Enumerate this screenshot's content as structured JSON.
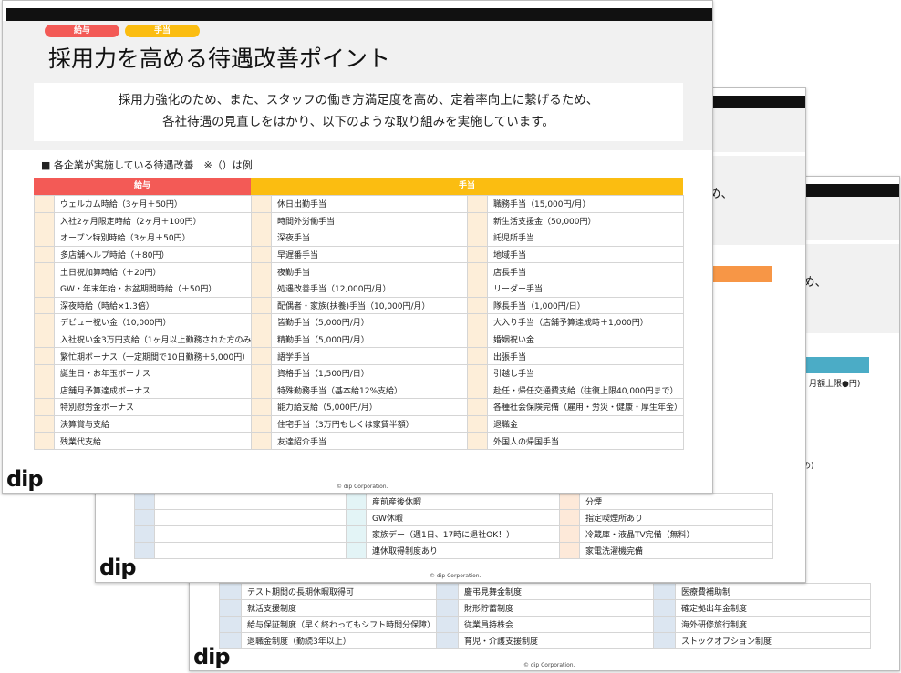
{
  "front": {
    "tags": [
      "給与",
      "手当"
    ],
    "title": "採用力を高める待遇改善ポイント",
    "lead_line1": "採用力強化のため、また、スタッフの働き方満足度を高め、定着率向上に繋げるため、",
    "lead_line2": "各社待遇の見直しをはかり、以下のような取り組みを実施しています。",
    "section_label": "■ 各企業が実施している待遇改善　※（）は例",
    "header_salary": "給与",
    "header_allowance": "手当",
    "colors": {
      "salary": "#f35a56",
      "allowance": "#fbbd11",
      "marker": "#fdeed9"
    },
    "rows": [
      [
        "ウェルカム時給（3ヶ月＋50円）",
        "休日出勤手当",
        "職務手当（15,000円/月）"
      ],
      [
        "入社2ヶ月限定時給（2ヶ月＋100円）",
        "時間外労働手当",
        "新生活支援金（50,000円）"
      ],
      [
        "オープン特別時給（3ヶ月＋50円）",
        "深夜手当",
        "託児所手当"
      ],
      [
        "多店舗ヘルプ時給（＋80円）",
        "早遅番手当",
        "地域手当"
      ],
      [
        "土日祝加算時給（＋20円）",
        "夜勤手当",
        "店長手当"
      ],
      [
        "GW・年末年始・お盆期間時給（＋50円）",
        "処遇改善手当（12,000円/月）",
        "リーダー手当"
      ],
      [
        "深夜時給（時給×1.3倍）",
        "配偶者・家族(扶養)手当（10,000円/月）",
        "隊長手当（1,000円/日）"
      ],
      [
        "デビュー祝い金（10,000円）",
        "皆勤手当（5,000円/月）",
        "大入り手当（店舗予算達成時＋1,000円）"
      ],
      [
        "入社祝い金3万円支給（1ヶ月以上勤務された方のみ）",
        "精勤手当（5,000円/月）",
        "婚姻祝い金"
      ],
      [
        "繁忙期ボーナス（一定期間で10日勤務＋5,000円）",
        "語学手当",
        "出張手当"
      ],
      [
        "誕生日・お年玉ボーナス",
        "資格手当（1,500円/日）",
        "引越し手当"
      ],
      [
        "店舗月予算達成ボーナス",
        "特殊勤務手当（基本給12%支給）",
        "赴任・帰任交通費支給（往復上限40,000円まで）"
      ],
      [
        "特別慰労金ボーナス",
        "能力給支給（5,000円/月）",
        "各種社会保険完備（雇用・労災・健康・厚生年金）"
      ],
      [
        "決算賞与支給",
        "住宅手当（3万円もしくは家賃半額）",
        "退職金"
      ],
      [
        "残業代支給",
        "友達紹介手当",
        "外国人の帰国手当"
      ]
    ],
    "logo": "dip",
    "copyright": "© dip Corporation."
  },
  "middle": {
    "partial_text1": "め、",
    "header_color": "#f79646",
    "rows": [
      [
        "",
        "産前産後休暇",
        "分煙"
      ],
      [
        "",
        "GW休暇",
        "指定喫煙所あり"
      ],
      [
        "",
        "家族デー（週1日、17時に退社OK！）",
        "冷蔵庫・液晶TV完備（無料）"
      ],
      [
        "",
        "連休取得制度あり",
        "家電洗濯機完備"
      ]
    ],
    "logo": "dip",
    "copyright": "© dip Corporation."
  },
  "back": {
    "partial_text1": "め、",
    "partial_text2": "、月額上限●円)",
    "partial_text3": "の)",
    "header_color": "#4bacc6",
    "rows": [
      [
        "テスト期間の長期休暇取得可",
        "慶弔見舞金制度",
        "医療費補助制"
      ],
      [
        "就活支援制度",
        "財形貯蓄制度",
        "確定拠出年金制度"
      ],
      [
        "給与保証制度（早く終わってもシフト時間分保障）",
        "従業員持株会",
        "海外研修旅行制度"
      ],
      [
        "退職金制度（勤続3年以上）",
        "育児・介護支援制度",
        "ストックオプション制度"
      ]
    ],
    "logo": "dip",
    "copyright": "© dip Corporation."
  }
}
